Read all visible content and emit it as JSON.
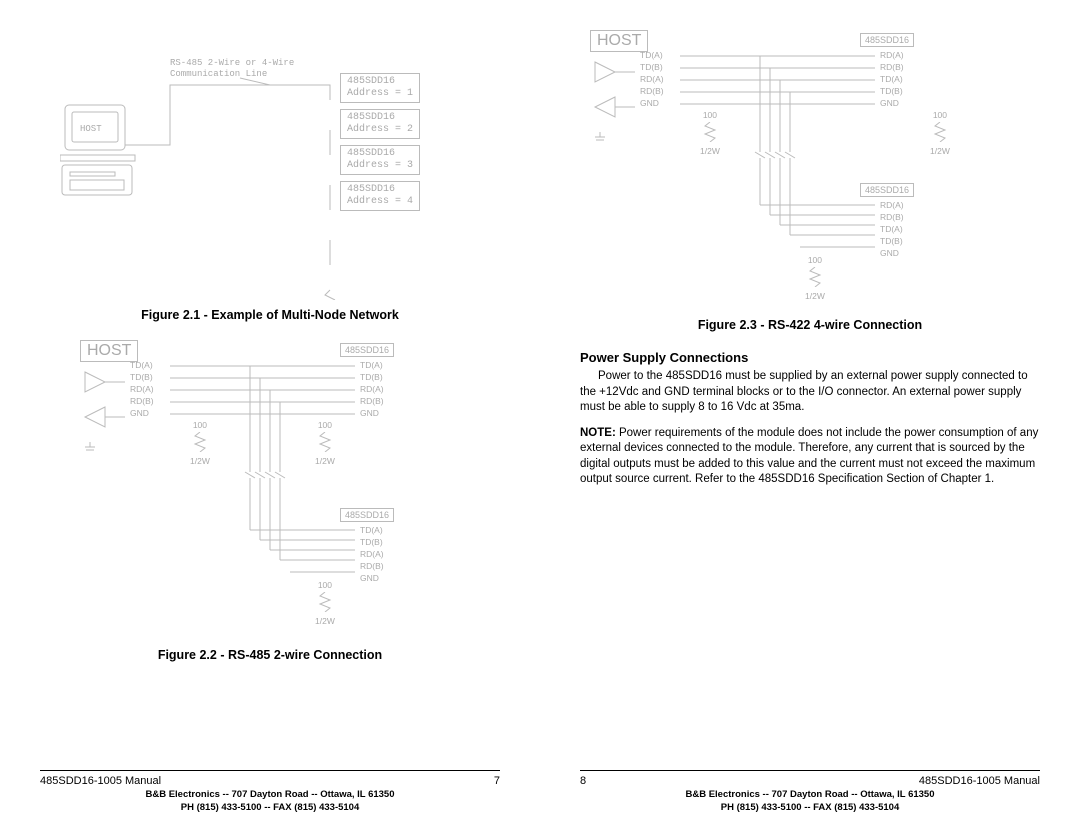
{
  "left_page": {
    "fig21": {
      "line_label1": "RS-485 2-Wire or 4-Wire",
      "line_label2": "Communication Line",
      "host_label": "HOST",
      "nodes": [
        {
          "name": "485SDD16",
          "addr": "Address = 1"
        },
        {
          "name": "485SDD16",
          "addr": "Address = 2"
        },
        {
          "name": "485SDD16",
          "addr": "Address = 3"
        },
        {
          "name": "485SDD16",
          "addr": "Address = 4"
        }
      ],
      "caption": "Figure 2.1 - Example of Multi-Node Network"
    },
    "fig22": {
      "host": "HOST",
      "module_top": "485SDD16",
      "module_bot": "485SDD16",
      "pins_host": [
        "TD(A)",
        "TD(B)",
        "RD(A)",
        "RD(B)",
        "GND"
      ],
      "pins_mod": [
        "TD(A)",
        "TD(B)",
        "RD(A)",
        "RD(B)",
        "GND"
      ],
      "res": "100",
      "watt": "1/2W",
      "caption": "Figure 2.2 - RS-485 2-wire Connection"
    },
    "footer": {
      "manual": "485SDD16-1005 Manual",
      "pagenum": "7",
      "addr": "B&B Electronics  --  707 Dayton Road  --  Ottawa, IL  61350",
      "phone": "PH (815) 433-5100  --  FAX (815) 433-5104"
    }
  },
  "right_page": {
    "fig23": {
      "host": "HOST",
      "module_top": "485SDD16",
      "module_bot": "485SDD16",
      "pins_host": [
        "TD(A)",
        "TD(B)",
        "RD(A)",
        "RD(B)",
        "GND"
      ],
      "pins_mod_top": [
        "RD(A)",
        "RD(B)",
        "TD(A)",
        "TD(B)",
        "GND"
      ],
      "pins_mod_bot": [
        "RD(A)",
        "RD(B)",
        "TD(A)",
        "TD(B)",
        "GND"
      ],
      "res": "100",
      "watt": "1/2W",
      "caption": "Figure 2.3 - RS-422 4-wire Connection"
    },
    "section_heading": "Power Supply Connections",
    "para1": "Power to the 485SDD16 must be supplied by an external power supply connected to the +12Vdc and GND terminal blocks or to the I/O connector.  An external power supply must be able to supply 8 to 16 Vdc at 35ma.",
    "para2_prefix": "NOTE:",
    "para2": "  Power requirements of the module does not include the power consumption of any external devices connected to the module.  Therefore, any current that is sourced by the digital outputs must be added to this value and the current must not exceed the maximum output source current.  Refer to the 485SDD16 Specification Section of Chapter 1.",
    "footer": {
      "manual": "485SDD16-1005 Manual",
      "pagenum": "8",
      "addr": "B&B Electronics  --  707 Dayton Road  --  Ottawa, IL  61350",
      "phone": "PH (815) 433-5100  --  FAX (815) 433-5104"
    }
  }
}
